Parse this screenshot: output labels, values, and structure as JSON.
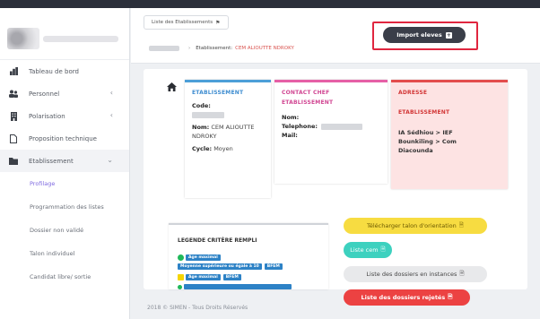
{
  "sidebar": {
    "nav": [
      {
        "label": "Tableau de bord",
        "icon": "dashboard-icon"
      },
      {
        "label": "Personnel",
        "icon": "users-icon",
        "chevron": "‹"
      },
      {
        "label": "Polarisation",
        "icon": "building-icon",
        "chevron": "‹"
      },
      {
        "label": "Proposition technique",
        "icon": "file-icon"
      },
      {
        "label": "Etablissement",
        "icon": "folder-icon",
        "chevron": "⌄"
      }
    ],
    "sub": [
      {
        "label": "Profilage",
        "active": true
      },
      {
        "label": "Programmation des listes"
      },
      {
        "label": "Dossier non validé"
      },
      {
        "label": "Talon individuel"
      },
      {
        "label": "Candidat libre/ sortie"
      }
    ]
  },
  "header": {
    "tab_label": "Liste des Etablissements",
    "tab_icon": "pin-icon",
    "breadcrumb_key": "Etablissement:",
    "breadcrumb_value": "CEM ALIOUTTE NDROKY",
    "import_label": "Import eleves",
    "import_icon": "plus-icon"
  },
  "etablissement": {
    "title": "ETABLISSEMENT",
    "code_label": "Code:",
    "nom_label": "Nom:",
    "nom_value": "CEM ALIOUTTE NDROKY",
    "cycle_label": "Cycle:",
    "cycle_value": "Moyen"
  },
  "contact": {
    "title_line1": "CONTACT CHEF",
    "title_line2": "ETABLISSEMENT",
    "nom_label": "Nom:",
    "tel_label": "Telephone:",
    "mail_label": "Mail:"
  },
  "adresse": {
    "title_line1": "ADRESSE",
    "title_line2": "ETABLISSEMENT",
    "line1": "IA Sédhiou > IEF",
    "line2": "Bounkiling > Com",
    "line3": "Diacounda"
  },
  "legend": {
    "title": "LEGENDE CRITÈRE REMPLI",
    "row1": [
      "Age maximal"
    ],
    "row2": [
      "Moyenne supérieure ou égale à 10",
      "BFEM"
    ],
    "row3": [
      "Age maximal",
      "BFEM"
    ],
    "colors": {
      "green": "#1fb85a",
      "yellow": "#f5d500",
      "tag_blue": "#2d82c6"
    }
  },
  "actions": {
    "talon": "Télécharger talon d'orientation",
    "liste_cem": "Liste cem",
    "liste_instances": "Liste des dossiers en instances",
    "liste_rejetes": "Liste des dossiers rejetés"
  },
  "footer": "2018 © SIMEN - Tous Droits Réservés"
}
